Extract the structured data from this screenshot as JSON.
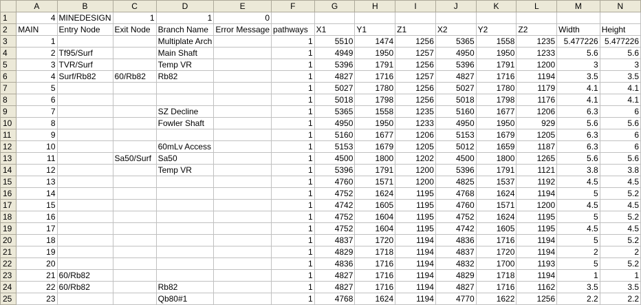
{
  "columns": [
    "A",
    "B",
    "C",
    "D",
    "E",
    "F",
    "G",
    "H",
    "I",
    "J",
    "K",
    "L",
    "M",
    "N"
  ],
  "rows": [
    {
      "n": "1",
      "cells": [
        "4",
        "MINEDESIGN",
        "1",
        "1",
        "0",
        "",
        "",
        "",
        "",
        "",
        "",
        "",
        "",
        ""
      ]
    },
    {
      "n": "2",
      "cells": [
        "MAIN",
        "Entry Node",
        "Exit Node",
        "Branch Name",
        "Error Message",
        "pathways",
        "X1",
        "Y1",
        "Z1",
        "X2",
        "Y2",
        "Z2",
        "Width",
        "Height"
      ]
    },
    {
      "n": "3",
      "cells": [
        "1",
        "",
        "",
        "Multiplate Arch",
        "",
        "1",
        "5510",
        "1474",
        "1256",
        "5365",
        "1558",
        "1235",
        "5.477226",
        "5.477226"
      ]
    },
    {
      "n": "4",
      "cells": [
        "2",
        "Tf95/Surf",
        "",
        "Main Shaft",
        "",
        "1",
        "4949",
        "1950",
        "1257",
        "4950",
        "1950",
        "1233",
        "5.6",
        "5.6"
      ]
    },
    {
      "n": "5",
      "cells": [
        "3",
        "TVR/Surf",
        "",
        "Temp VR",
        "",
        "1",
        "5396",
        "1791",
        "1256",
        "5396",
        "1791",
        "1200",
        "3",
        "3"
      ]
    },
    {
      "n": "6",
      "cells": [
        "4",
        "Surf/Rb82",
        "60/Rb82",
        "Rb82",
        "",
        "1",
        "4827",
        "1716",
        "1257",
        "4827",
        "1716",
        "1194",
        "3.5",
        "3.5"
      ]
    },
    {
      "n": "7",
      "cells": [
        "5",
        "",
        "",
        "",
        "",
        "1",
        "5027",
        "1780",
        "1256",
        "5027",
        "1780",
        "1179",
        "4.1",
        "4.1"
      ]
    },
    {
      "n": "8",
      "cells": [
        "6",
        "",
        "",
        "",
        "",
        "1",
        "5018",
        "1798",
        "1256",
        "5018",
        "1798",
        "1176",
        "4.1",
        "4.1"
      ]
    },
    {
      "n": "9",
      "cells": [
        "7",
        "",
        "",
        "SZ Decline",
        "",
        "1",
        "5365",
        "1558",
        "1235",
        "5160",
        "1677",
        "1206",
        "6.3",
        "6"
      ]
    },
    {
      "n": "10",
      "cells": [
        "8",
        "",
        "",
        "Fowler Shaft",
        "",
        "1",
        "4950",
        "1950",
        "1233",
        "4950",
        "1950",
        "929",
        "5.6",
        "5.6"
      ]
    },
    {
      "n": "11",
      "cells": [
        "9",
        "",
        "",
        "",
        "",
        "1",
        "5160",
        "1677",
        "1206",
        "5153",
        "1679",
        "1205",
        "6.3",
        "6"
      ]
    },
    {
      "n": "12",
      "cells": [
        "10",
        "",
        "",
        "60mLv Access",
        "",
        "1",
        "5153",
        "1679",
        "1205",
        "5012",
        "1659",
        "1187",
        "6.3",
        "6"
      ]
    },
    {
      "n": "13",
      "cells": [
        "11",
        "",
        "Sa50/Surf",
        "Sa50",
        "",
        "1",
        "4500",
        "1800",
        "1202",
        "4500",
        "1800",
        "1265",
        "5.6",
        "5.6"
      ]
    },
    {
      "n": "14",
      "cells": [
        "12",
        "",
        "",
        "Temp VR",
        "",
        "1",
        "5396",
        "1791",
        "1200",
        "5396",
        "1791",
        "1121",
        "3.8",
        "3.8"
      ]
    },
    {
      "n": "15",
      "cells": [
        "13",
        "",
        "",
        "",
        "",
        "1",
        "4760",
        "1571",
        "1200",
        "4825",
        "1537",
        "1192",
        "4.5",
        "4.5"
      ]
    },
    {
      "n": "16",
      "cells": [
        "14",
        "",
        "",
        "",
        "",
        "1",
        "4752",
        "1624",
        "1195",
        "4768",
        "1624",
        "1194",
        "5",
        "5.2"
      ]
    },
    {
      "n": "17",
      "cells": [
        "15",
        "",
        "",
        "",
        "",
        "1",
        "4742",
        "1605",
        "1195",
        "4760",
        "1571",
        "1200",
        "4.5",
        "4.5"
      ]
    },
    {
      "n": "18",
      "cells": [
        "16",
        "",
        "",
        "",
        "",
        "1",
        "4752",
        "1604",
        "1195",
        "4752",
        "1624",
        "1195",
        "5",
        "5.2"
      ]
    },
    {
      "n": "19",
      "cells": [
        "17",
        "",
        "",
        "",
        "",
        "1",
        "4752",
        "1604",
        "1195",
        "4742",
        "1605",
        "1195",
        "4.5",
        "4.5"
      ]
    },
    {
      "n": "20",
      "cells": [
        "18",
        "",
        "",
        "",
        "",
        "1",
        "4837",
        "1720",
        "1194",
        "4836",
        "1716",
        "1194",
        "5",
        "5.2"
      ]
    },
    {
      "n": "21",
      "cells": [
        "19",
        "",
        "",
        "",
        "",
        "1",
        "4829",
        "1718",
        "1194",
        "4837",
        "1720",
        "1194",
        "2",
        "2"
      ]
    },
    {
      "n": "22",
      "cells": [
        "20",
        "",
        "",
        "",
        "",
        "1",
        "4836",
        "1716",
        "1194",
        "4832",
        "1700",
        "1193",
        "5",
        "5.2"
      ]
    },
    {
      "n": "23",
      "cells": [
        "21",
        "60/Rb82",
        "",
        "",
        "",
        "1",
        "4827",
        "1716",
        "1194",
        "4829",
        "1718",
        "1194",
        "1",
        "1"
      ]
    },
    {
      "n": "24",
      "cells": [
        "22",
        "60/Rb82",
        "",
        "Rb82",
        "",
        "1",
        "4827",
        "1716",
        "1194",
        "4827",
        "1716",
        "1162",
        "3.5",
        "3.5"
      ]
    },
    {
      "n": "25",
      "cells": [
        "23",
        "",
        "",
        "Qb80#1",
        "",
        "1",
        "4768",
        "1624",
        "1194",
        "4770",
        "1622",
        "1256",
        "2.2",
        "2.2"
      ]
    }
  ],
  "colors": {
    "header_bg": "#ece9d8",
    "grid": "#c0c0c0"
  }
}
